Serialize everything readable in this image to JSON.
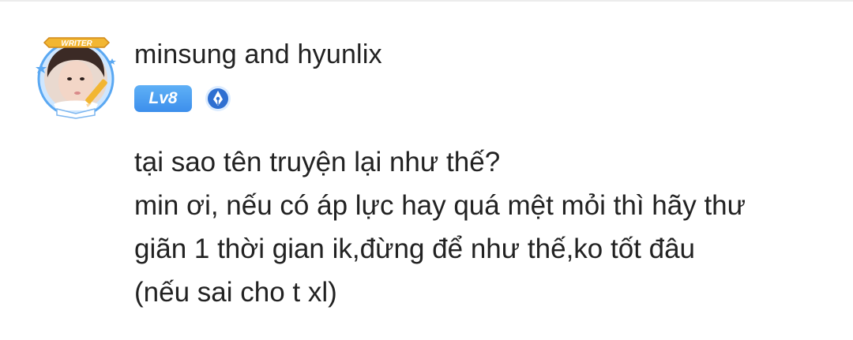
{
  "comment": {
    "username": "minsung and hyunlix",
    "avatar_frame_label": "WRITER",
    "level_badge": "Lv8",
    "writer_badge_icon": "pen-nib-icon",
    "body_lines": [
      "tại sao tên truyện lại như thế?",
      "min ơi, nếu có áp lực hay quá mệt mỏi thì hãy thư",
      "giãn 1 thời gian ik,đừng để như thế,ko tốt đâu",
      "(nếu sai cho t xl)"
    ]
  },
  "colors": {
    "text": "#222222",
    "level_badge": "#4a9cf0",
    "writer_badge": "#2f6fd1",
    "frame_gold": "#f2b632"
  }
}
